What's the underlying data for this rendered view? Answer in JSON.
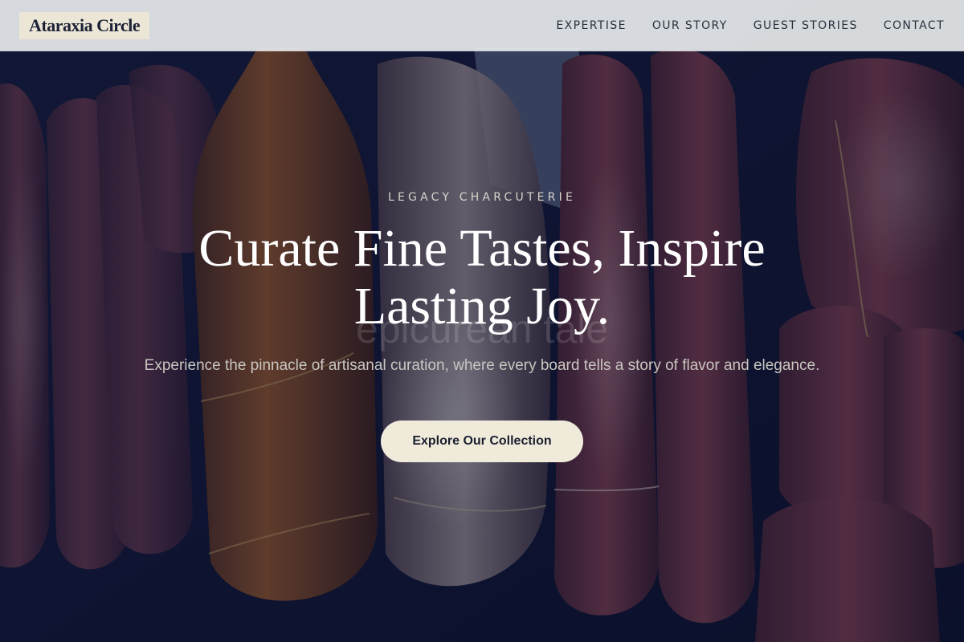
{
  "header": {
    "logo_text": "Ataraxia Circle",
    "nav": [
      {
        "label": "EXPERTISE"
      },
      {
        "label": "OUR STORY"
      },
      {
        "label": "GUEST STORIES"
      },
      {
        "label": "CONTACT"
      }
    ]
  },
  "hero": {
    "eyebrow": "LEGACY CHARCUTERIE",
    "title": "Curate Fine Tastes, Inspire Lasting Joy.",
    "ghost_word": "epicurean tale",
    "subtitle": "Experience the pinnacle of artisanal curation, where every board tells a story of flavor and elegance.",
    "cta_label": "Explore Our Collection"
  },
  "colors": {
    "header_bg": "#eceef0",
    "logo_bg": "#ebe6d6",
    "text_dark": "#1c2236",
    "overlay": "#0e1530",
    "cta_bg": "#f0eadb"
  }
}
